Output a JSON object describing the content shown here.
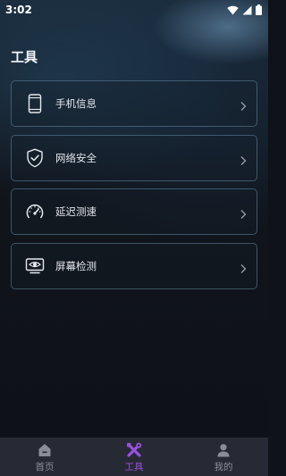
{
  "status_bar": {
    "time": "3:02"
  },
  "page": {
    "title": "工具"
  },
  "tools": [
    {
      "label": "手机信息",
      "icon": "phone-icon"
    },
    {
      "label": "网络安全",
      "icon": "shield-check-icon"
    },
    {
      "label": "延迟测速",
      "icon": "speedometer-icon"
    },
    {
      "label": "屏幕检测",
      "icon": "monitor-eye-icon"
    }
  ],
  "bottom_nav": {
    "items": [
      {
        "label": "首页",
        "icon": "home-icon",
        "active": false
      },
      {
        "label": "工具",
        "icon": "tools-icon",
        "active": true
      },
      {
        "label": "我的",
        "icon": "profile-icon",
        "active": false
      }
    ]
  },
  "colors": {
    "accent": "#9a4fe0",
    "nav_inactive": "#8a8d96",
    "card_border": "#78a0be"
  }
}
